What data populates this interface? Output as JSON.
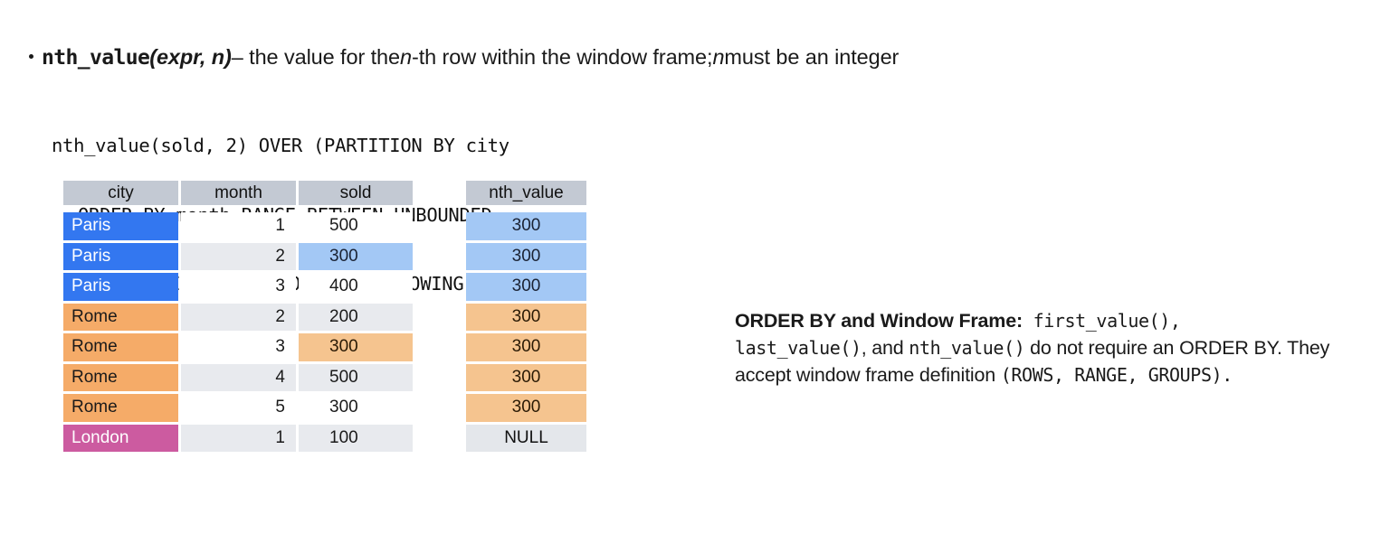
{
  "slide": {
    "bullet": {
      "function_name": "nth_value",
      "function_args": "(expr, n)",
      "dash": " – the value for the ",
      "emph_n": "n",
      "rest": "-th row within the window frame; ",
      "emph_n2": "n",
      "tail": " must be an integer"
    },
    "code": {
      "line1": "nth_value(sold, 2) OVER (PARTITION BY city",
      "line2": "ORDER BY month RANGE BETWEEN UNBOUNDED",
      "line3": "PRECEDING AND UNBOUNDED FOLLOWING)"
    },
    "table": {
      "headers": {
        "city": "city",
        "month": "month",
        "sold": "sold",
        "nth_value": "nth_value"
      },
      "rows": [
        {
          "city": "Paris",
          "month": "1",
          "sold": "500",
          "nth_value": "300"
        },
        {
          "city": "Paris",
          "month": "2",
          "sold": "300",
          "nth_value": "300"
        },
        {
          "city": "Paris",
          "month": "3",
          "sold": "400",
          "nth_value": "300"
        },
        {
          "city": "Rome",
          "month": "2",
          "sold": "200",
          "nth_value": "300"
        },
        {
          "city": "Rome",
          "month": "3",
          "sold": "300",
          "nth_value": "300"
        },
        {
          "city": "Rome",
          "month": "4",
          "sold": "500",
          "nth_value": "300"
        },
        {
          "city": "Rome",
          "month": "5",
          "sold": "300",
          "nth_value": "300"
        },
        {
          "city": "London",
          "month": "1",
          "sold": "100",
          "nth_value": "NULL"
        }
      ]
    },
    "note": {
      "label": "ORDER BY and Window Frame:",
      "fn1": " first_value(),",
      "fn2": "last_value()",
      "mid1": ", and ",
      "fn3": "nth_value()",
      "mid2": " do not require an ORDER BY. They accept window frame definition ",
      "fn4": "(ROWS, RANGE, GROUPS)."
    },
    "colors": {
      "paris": "#3377f0",
      "rome": "#f5ab68",
      "london": "#cc5ba0",
      "header": "#c3c9d3",
      "highlight_blue": "#a3c8f5",
      "highlight_orange": "#f5c48f",
      "stripe": "#e8eaee",
      "null_cell": "#e4e7eb"
    }
  }
}
